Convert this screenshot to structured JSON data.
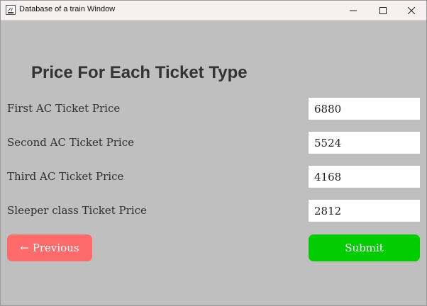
{
  "window": {
    "title": "Database of a train Window",
    "icon": "java-app-icon",
    "controls": {
      "minimize": "minimize-icon",
      "maximize": "maximize-icon",
      "close": "close-icon"
    }
  },
  "form": {
    "heading": "Price For Each Ticket Type",
    "rows": [
      {
        "label": "First AC Ticket Price",
        "value": "6880"
      },
      {
        "label": "Second AC Ticket Price",
        "value": "5524"
      },
      {
        "label": "Third AC Ticket Price",
        "value": "4168"
      },
      {
        "label": "Sleeper class Ticket Price",
        "value": "2812"
      }
    ],
    "previous_label": "← Previous",
    "submit_label": "Submit"
  },
  "colors": {
    "background": "#bfbfbf",
    "previous_button": "#ff6b6b",
    "submit_button": "#00cc00"
  }
}
